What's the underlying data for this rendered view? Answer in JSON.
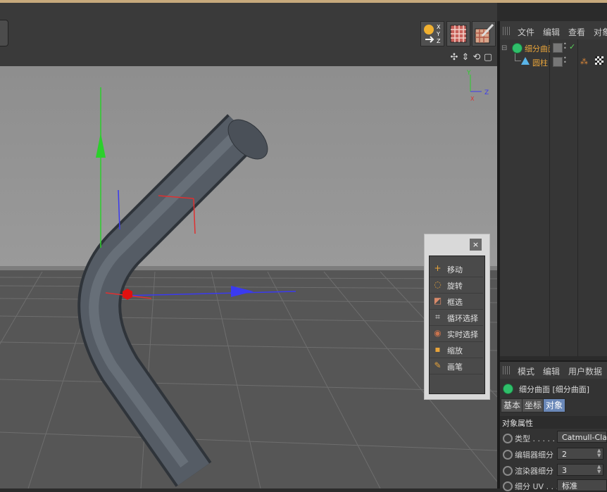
{
  "object_manager": {
    "menus": [
      "文件",
      "编辑",
      "查看",
      "对象"
    ],
    "objects": [
      {
        "name": "细分曲面",
        "icon": "subdivision-surface-icon"
      },
      {
        "name": "圆柱",
        "icon": "cylinder-icon"
      }
    ]
  },
  "viewport": {
    "axis_labels": {
      "y": "Y",
      "z": "Z",
      "x": "X"
    },
    "toolbar_axis_labels": [
      "X",
      "Y",
      "Z"
    ]
  },
  "attributes": {
    "menus": [
      "模式",
      "编辑",
      "用户数据"
    ],
    "object_title": "细分曲面 [细分曲面]",
    "tabs": [
      "基本",
      "坐标",
      "对象"
    ],
    "active_tab": "对象",
    "section": "对象属性",
    "rows": [
      {
        "label": "类型 . . . . .",
        "value": "Catmull-Clar"
      },
      {
        "label": "编辑器细分",
        "value": "2"
      },
      {
        "label": "渲染器细分",
        "value": "3"
      },
      {
        "label": "细分 UV . . .",
        "value": "标准"
      }
    ]
  },
  "palette": {
    "close": "×",
    "items": [
      {
        "label": "移动",
        "icon": "move-icon"
      },
      {
        "label": "旋转",
        "icon": "rotate-icon"
      },
      {
        "label": "框选",
        "icon": "box-select-icon"
      },
      {
        "label": "循环选择",
        "icon": "loop-select-icon"
      },
      {
        "label": "实时选择",
        "icon": "live-select-icon"
      },
      {
        "label": "缩放",
        "icon": "scale-icon"
      },
      {
        "label": "画笔",
        "icon": "brush-icon"
      }
    ]
  },
  "colors": {
    "accent_selected": "#e8a43a",
    "y_axis": "#2bd02b",
    "z_axis": "#3a3af0",
    "x_axis": "#e03030"
  }
}
